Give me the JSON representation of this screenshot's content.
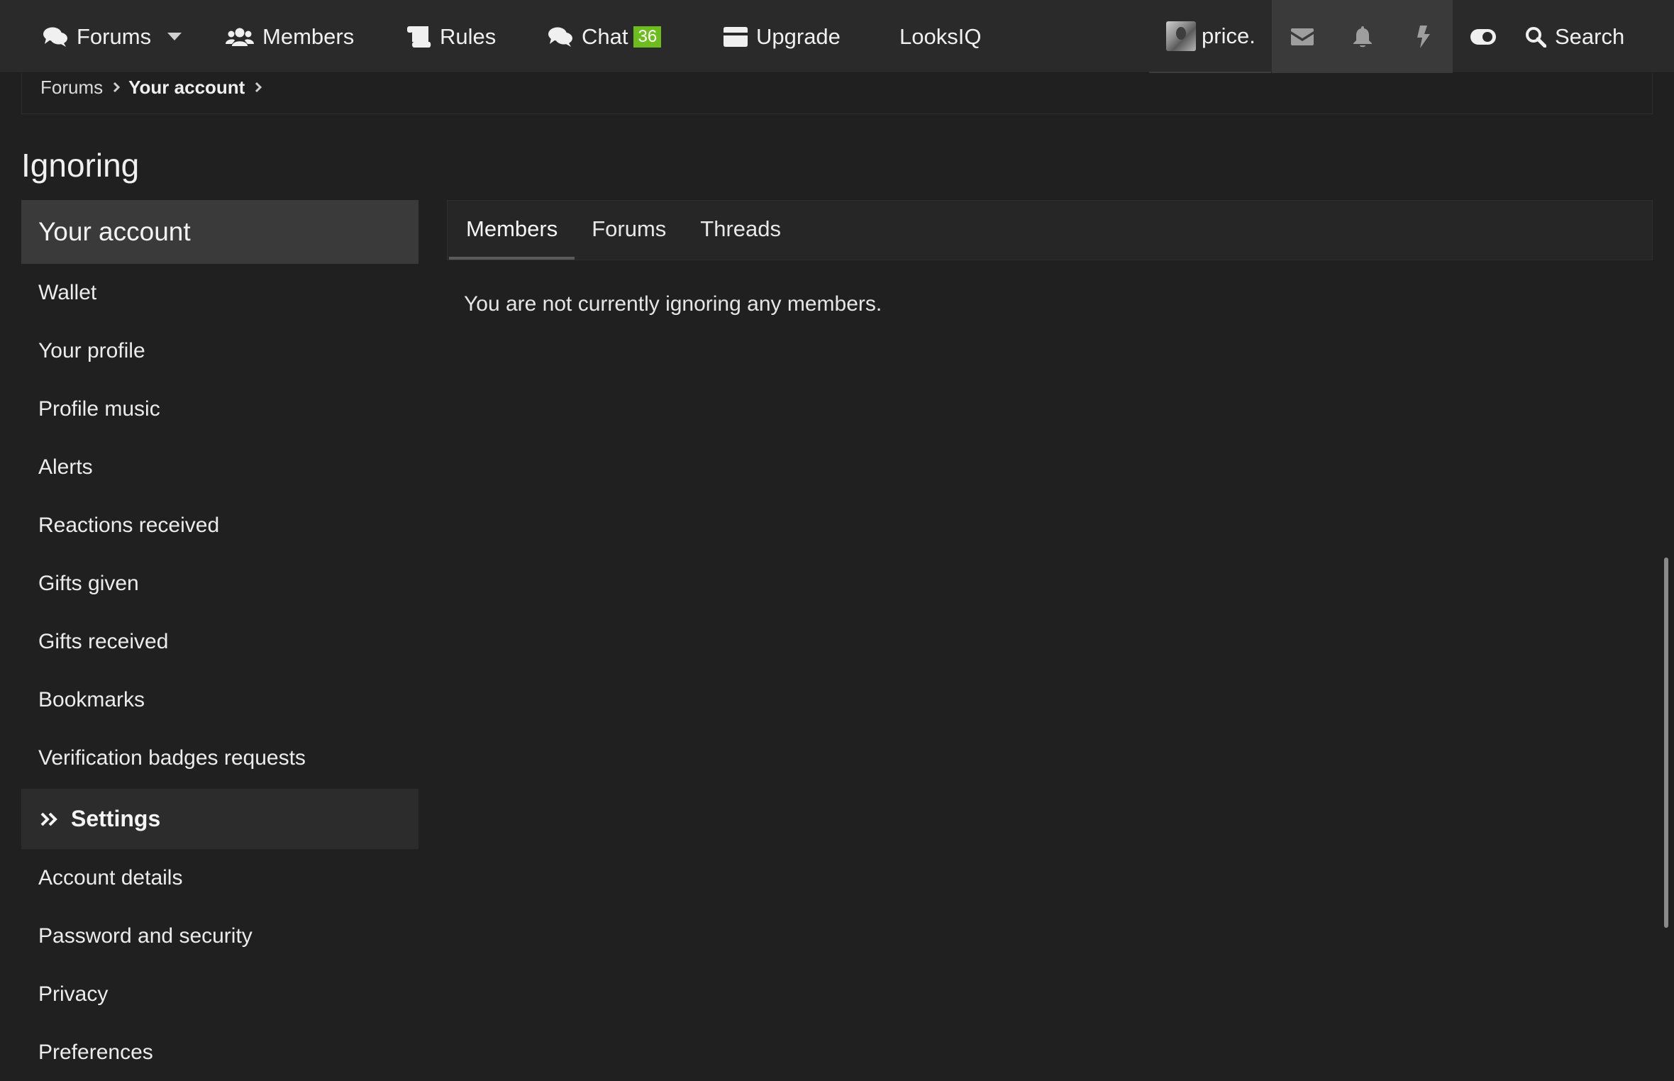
{
  "nav": {
    "forums": "Forums",
    "members": "Members",
    "rules": "Rules",
    "chat": "Chat",
    "chat_badge": "36",
    "upgrade": "Upgrade",
    "looksiq": "LooksIQ",
    "search": "Search"
  },
  "user": {
    "name": "price."
  },
  "breadcrumb": {
    "items": [
      "Forums",
      "Your account"
    ]
  },
  "page": {
    "title": "Ignoring"
  },
  "sidebar": {
    "header": "Your account",
    "account_items": [
      "Wallet",
      "Your profile",
      "Profile music",
      "Alerts",
      "Reactions received",
      "Gifts given",
      "Gifts received",
      "Bookmarks",
      "Verification badges requests"
    ],
    "settings_label": "Settings",
    "settings_items": [
      "Account details",
      "Password and security",
      "Privacy",
      "Preferences"
    ]
  },
  "tabs": {
    "items": [
      "Members",
      "Forums",
      "Threads"
    ],
    "active": "Members"
  },
  "main": {
    "empty_message": "You are not currently ignoring any members."
  },
  "colors": {
    "background": "#202020",
    "topbar": "#2a2a2a",
    "badge": "#6ebd1f",
    "sidebar_header": "#3a3a3a"
  },
  "icons": {
    "forums": "comments-icon",
    "members": "users-icon",
    "rules": "scroll-icon",
    "chat": "comments-icon",
    "upgrade": "credit-card-icon",
    "inbox": "envelope-icon",
    "alerts": "bell-icon",
    "whats_new": "bolt-icon",
    "style": "toggle-icon",
    "search": "search-icon",
    "settings": "double-chevron-right-icon"
  }
}
